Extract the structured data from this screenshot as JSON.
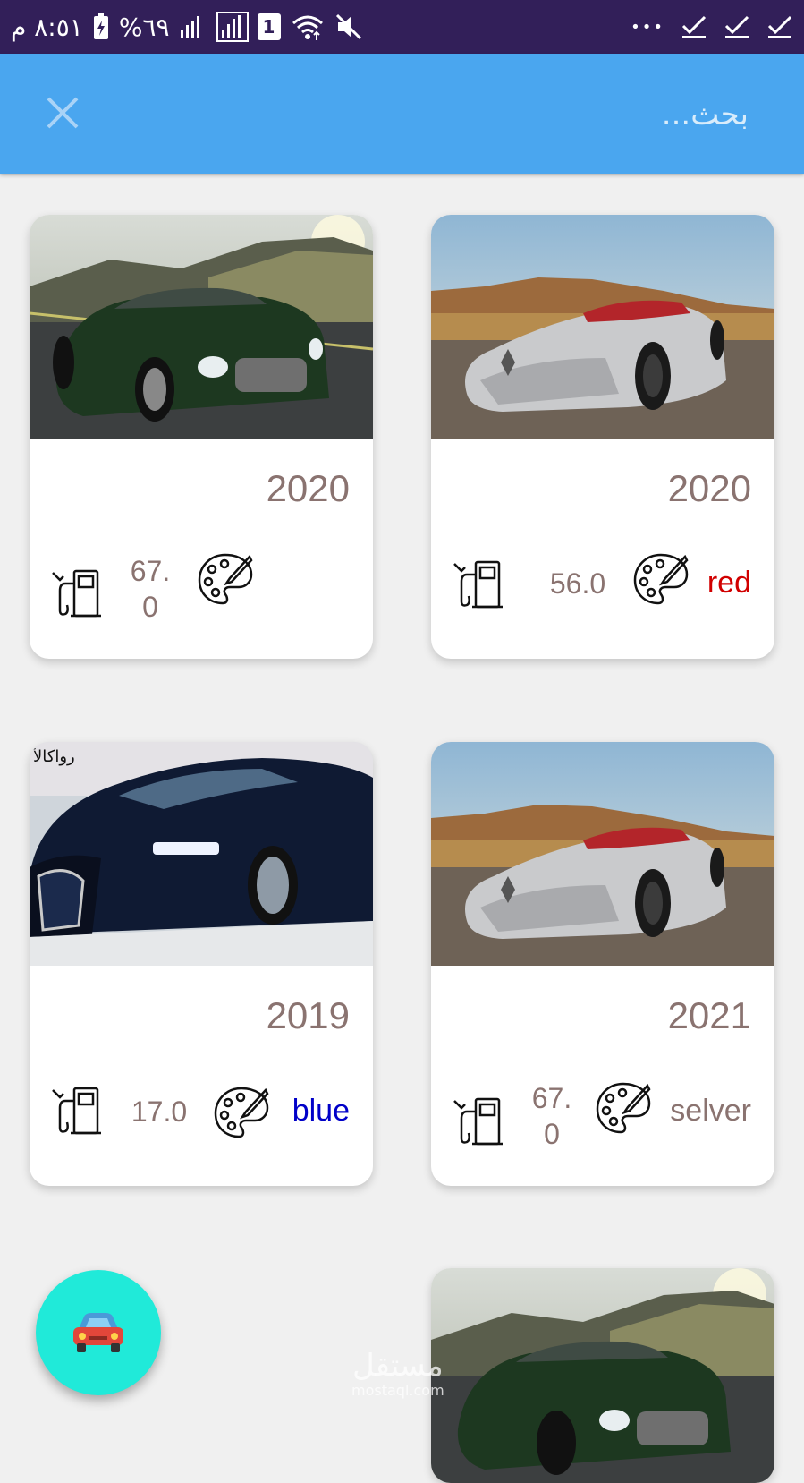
{
  "status_bar": {
    "time": "٨:٥١ م",
    "battery_percent": "%٦٩",
    "sim_slot": "1",
    "more": "•••"
  },
  "search": {
    "placeholder": "بحث..."
  },
  "cars": [
    {
      "year": "2020",
      "fuel": "67.0",
      "color_label": "",
      "color": "#8a7370"
    },
    {
      "year": "2020",
      "fuel": "56.0",
      "color_label": "red",
      "color": "#d10000"
    },
    {
      "year": "2019",
      "fuel": "17.0",
      "color_label": "blue",
      "color": "#0000c8"
    },
    {
      "year": "2021",
      "fuel": "67.0",
      "color_label": "selver",
      "color": "#8a7370"
    }
  ],
  "fab": {
    "icon": "car-icon"
  },
  "watermark": {
    "brand": "مستقل",
    "url": "mostaql.com"
  },
  "colors": {
    "status_bar": "#321f59",
    "app_bar": "#4aa6ef",
    "fab": "#20ead9",
    "value_text": "#8a7370"
  }
}
